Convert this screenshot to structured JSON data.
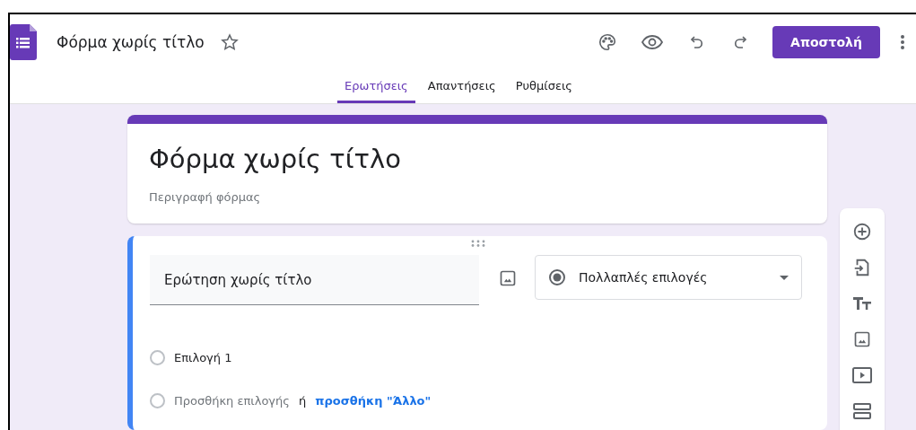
{
  "header": {
    "title": "Φόρμα χωρίς τίτλο",
    "send_button": "Αποστολή"
  },
  "tabs": [
    {
      "label": "Ερωτήσεις",
      "selected": true
    },
    {
      "label": "Απαντήσεις",
      "selected": false
    },
    {
      "label": "Ρυθμίσεις",
      "selected": false
    }
  ],
  "form_header": {
    "title": "Φόρμα χωρίς τίτλο",
    "description_placeholder": "Περιγραφή φόρμας"
  },
  "question": {
    "title_placeholder": "Ερώτηση χωρίς τίτλο",
    "type": "Πολλαπλές επιλογές",
    "options": [
      {
        "label": "Επιλογή 1",
        "selected": false
      }
    ],
    "add_option": {
      "selected": false,
      "text": "Προσθήκη επιλογής",
      "separator": "ή",
      "link": "προσθήκη \"Άλλο\""
    }
  }
}
